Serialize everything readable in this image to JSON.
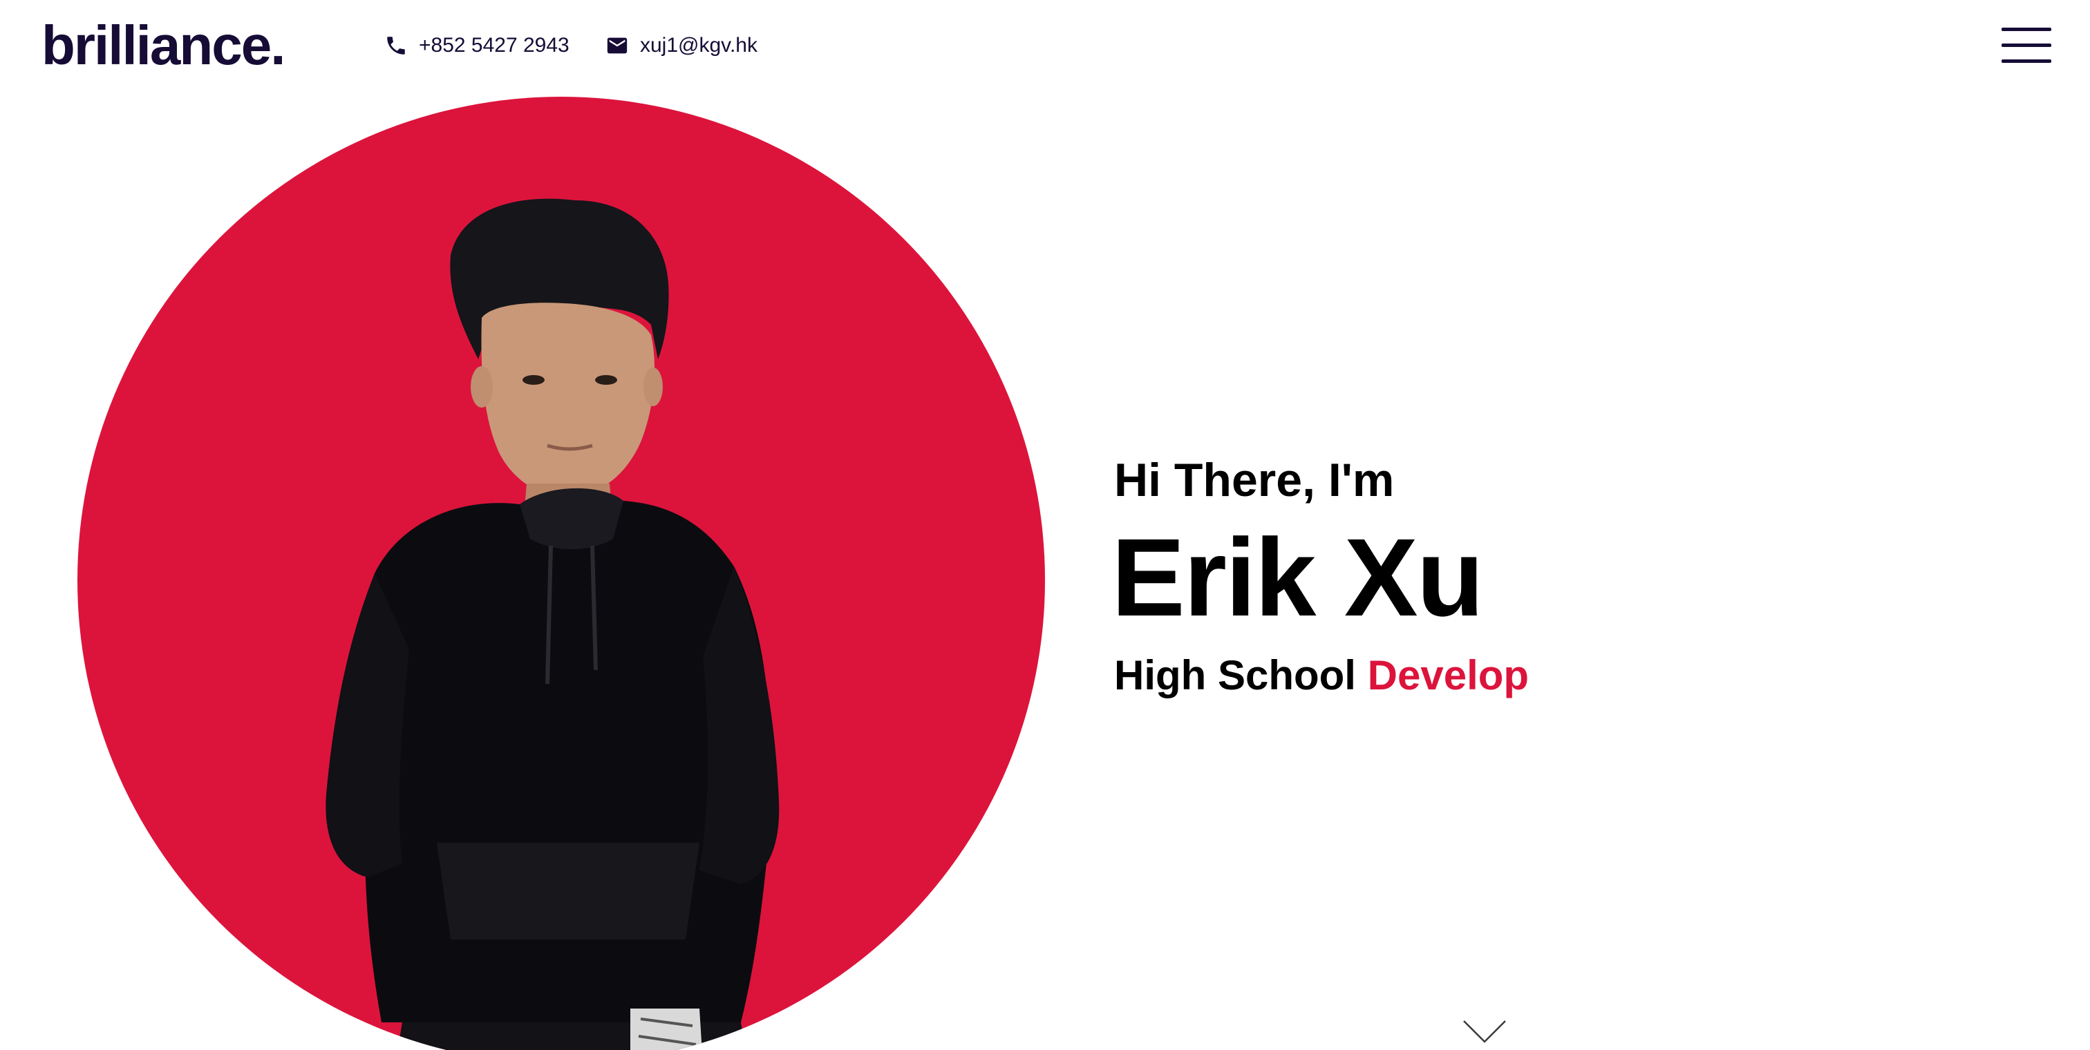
{
  "header": {
    "logo": "brilliance.",
    "phone": {
      "icon": "phone-icon",
      "text": "+852 5427 2943"
    },
    "email": {
      "icon": "mail-icon",
      "text": "xuj1@kgv.hk"
    },
    "menu_icon": "hamburger-menu-icon"
  },
  "hero": {
    "greeting": "Hi There, I'm",
    "name": "Erik Xu",
    "role_prefix": "High School",
    "role_highlight": "Develop",
    "portrait_image": "portrait-photo",
    "scroll_icon": "chevron-down-icon"
  },
  "colors": {
    "accent": "#dc143c",
    "navy": "#160c36",
    "text": "#000000",
    "background": "#ffffff"
  }
}
